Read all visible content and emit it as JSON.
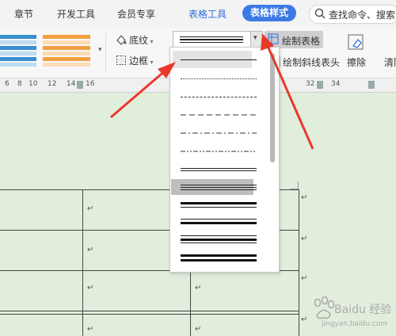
{
  "tabs": [
    {
      "label": "章节"
    },
    {
      "label": "开发工具"
    },
    {
      "label": "会员专享"
    },
    {
      "label": "表格工具"
    },
    {
      "label": "表格样式"
    }
  ],
  "search": {
    "placeholder": "查找命令、搜索"
  },
  "ribbon": {
    "shading_label": "底纹",
    "border_label": "边框",
    "draw_table_label": "绘制表格",
    "draw_diagonal_label": "绘制斜线表头",
    "eraser_label": "擦除",
    "clear_label": "清除"
  },
  "ruler": {
    "numbers": [
      "6",
      "8",
      "10",
      "12",
      "14",
      "16",
      "32",
      "34"
    ]
  },
  "cell_mark": "↵",
  "watermark": {
    "site": "Baidu 经验",
    "url": "jingyan.baidu.com"
  },
  "colors": {
    "tab_active_bg": "#3b7ae6",
    "tab_blue_text": "#2f6fe0",
    "page_bg": "#e2eedc",
    "arrow": "#e8392b",
    "selected_style_bg": "#bebebe"
  },
  "icons": [
    "search-icon",
    "shading-icon",
    "border-icon",
    "draw-table-icon",
    "draw-diagonal-icon",
    "eraser-icon",
    "chevron-down-icon"
  ]
}
